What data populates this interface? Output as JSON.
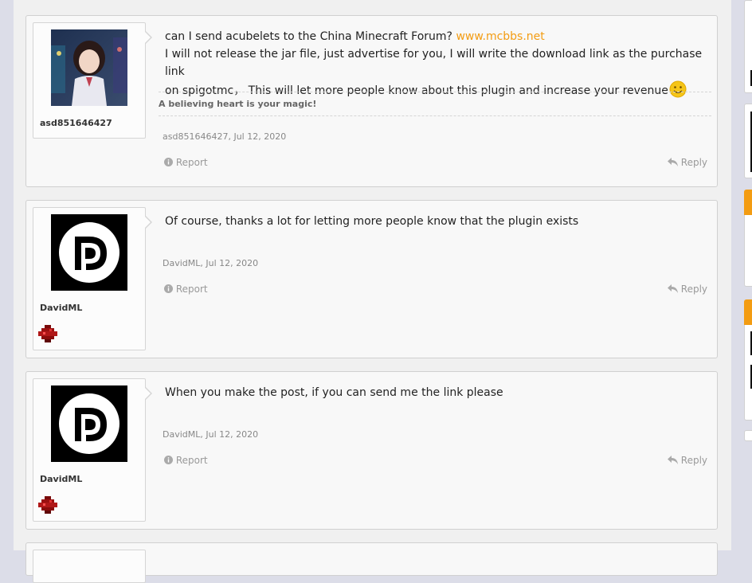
{
  "posts": [
    {
      "username": "asd851646427",
      "message_line1": "can I send acubelets to the China Minecraft Forum? ",
      "message_link": "www.mcbbs.net",
      "message_line2": "I will not release the jar file, just advertise for you, I will write the download link as the purchase link",
      "message_line3": "on spigotmc， This will let more people know about this plugin and increase your revenue",
      "signature": "A believing heart is your magic!",
      "author": "asd851646427",
      "date": "Jul 12, 2020",
      "report_label": "Report",
      "reply_label": "Reply"
    },
    {
      "username": "DavidML",
      "message": "Of course, thanks a lot for letting more people know that the plugin exists",
      "author": "DavidML",
      "date": "Jul 12, 2020",
      "report_label": "Report",
      "reply_label": "Reply"
    },
    {
      "username": "DavidML",
      "message": "When you make the post, if you can send me the link please",
      "author": "DavidML",
      "date": "Jul 12, 2020",
      "report_label": "Report",
      "reply_label": "Reply"
    }
  ],
  "colors": {
    "link": "#f39c12",
    "accent_orange": "#f39c12",
    "post_bg": "#f8f8f8"
  },
  "icons": {
    "report": "info-circle-icon",
    "reply": "reply-arrow-icon",
    "smiley": "smiley-emoji-icon",
    "badge": "redstone-badge-icon"
  }
}
